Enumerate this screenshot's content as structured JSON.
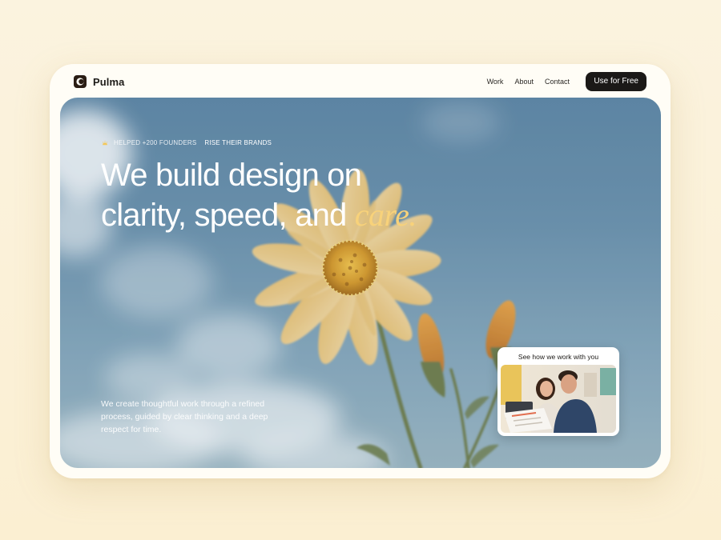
{
  "brand": {
    "name": "Pulma",
    "icon": "pulma-logo-icon"
  },
  "nav": {
    "items": [
      {
        "label": "Work"
      },
      {
        "label": "About"
      },
      {
        "label": "Contact"
      }
    ],
    "cta_label": "Use for Free"
  },
  "hero": {
    "eyebrow_icon": "sun-icon",
    "eyebrow_text": "HELPED +200 FOUNDERS",
    "eyebrow_strong": "RISE THEIR BRANDS",
    "headline_line1": "We build design on",
    "headline_line2": "clarity, speed, and ",
    "headline_accent": "care.",
    "description": "We create thoughtful work through a refined process, guided by clear thinking and a deep respect for time.",
    "video_card_title": "See how we work with you"
  },
  "colors": {
    "accent": "#f8d27a",
    "cta_background": "#1b1917",
    "page_background": "#fbf3df"
  }
}
